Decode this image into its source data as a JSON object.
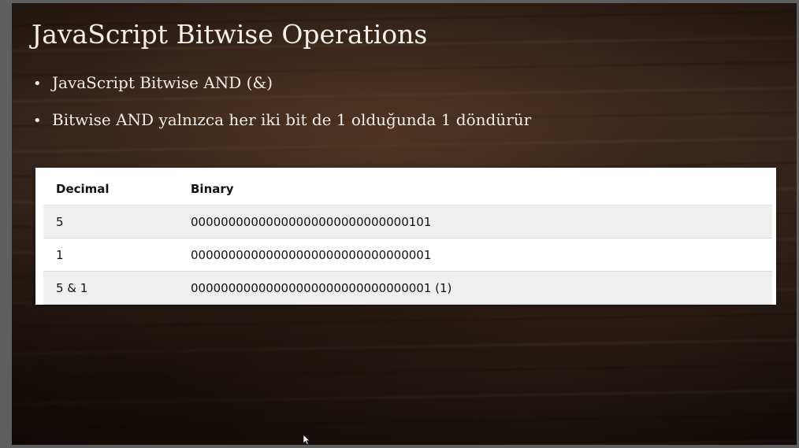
{
  "slide": {
    "title": "JavaScript Bitwise Operations",
    "bullets": [
      "JavaScript Bitwise AND (&)",
      "Bitwise AND yalnızca her iki bit de 1 olduğunda 1 döndürür"
    ],
    "bullet_glyph": "•"
  },
  "table": {
    "headers": [
      "Decimal",
      "Binary"
    ],
    "rows": [
      [
        "5",
        "00000000000000000000000000000101"
      ],
      [
        "1",
        "00000000000000000000000000000001"
      ],
      [
        "5 & 1",
        "00000000000000000000000000000001 (1)"
      ]
    ]
  },
  "icons": {
    "cursor": "mouse-pointer-icon"
  }
}
